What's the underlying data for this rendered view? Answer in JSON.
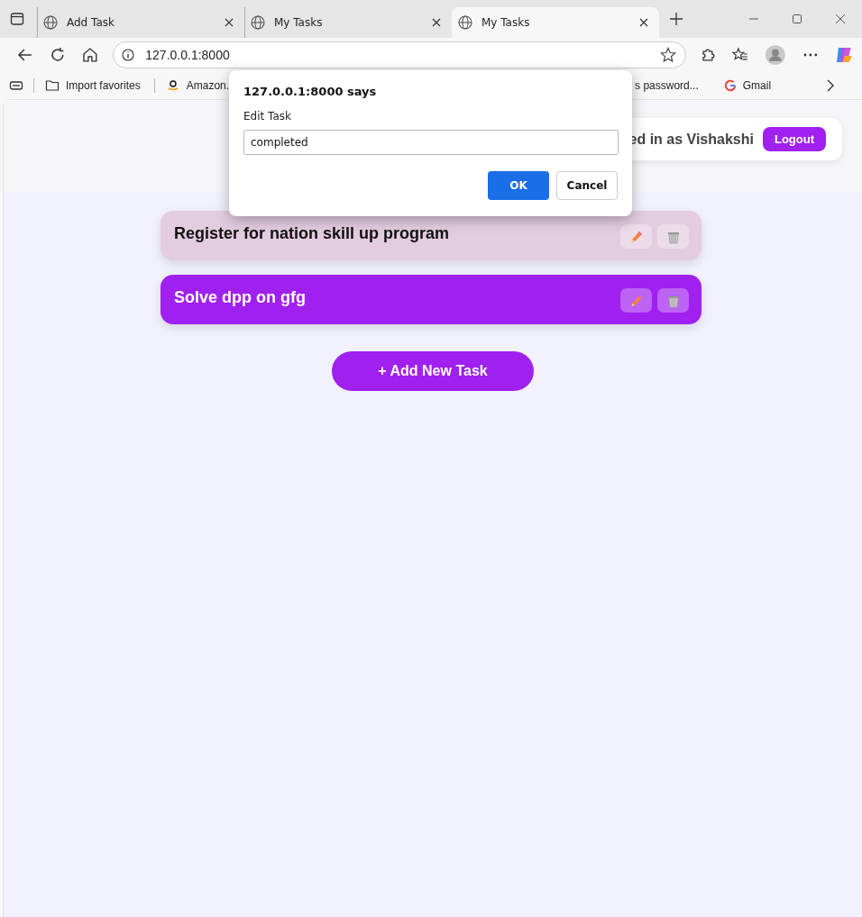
{
  "tabs": [
    {
      "label": "Add Task",
      "selected": false
    },
    {
      "label": "My Tasks",
      "selected": false
    },
    {
      "label": "My Tasks",
      "selected": true
    }
  ],
  "address_bar": {
    "url": "127.0.0.1:8000"
  },
  "bookmarks": [
    "Import favorites",
    "Amazon.",
    "s password...",
    "Gmail"
  ],
  "header": {
    "user_text": "ed in as Vishakshi",
    "logout": "Logout"
  },
  "tasks": [
    {
      "title": "Register for nation skill up program",
      "completed": true
    },
    {
      "title": "Solve dpp on gfg",
      "completed": false
    }
  ],
  "add_button": "+ Add New Task",
  "dialog": {
    "title": "127.0.0.1:8000 says",
    "label": "Edit Task",
    "value": "completed",
    "ok": "OK",
    "cancel": "Cancel"
  }
}
